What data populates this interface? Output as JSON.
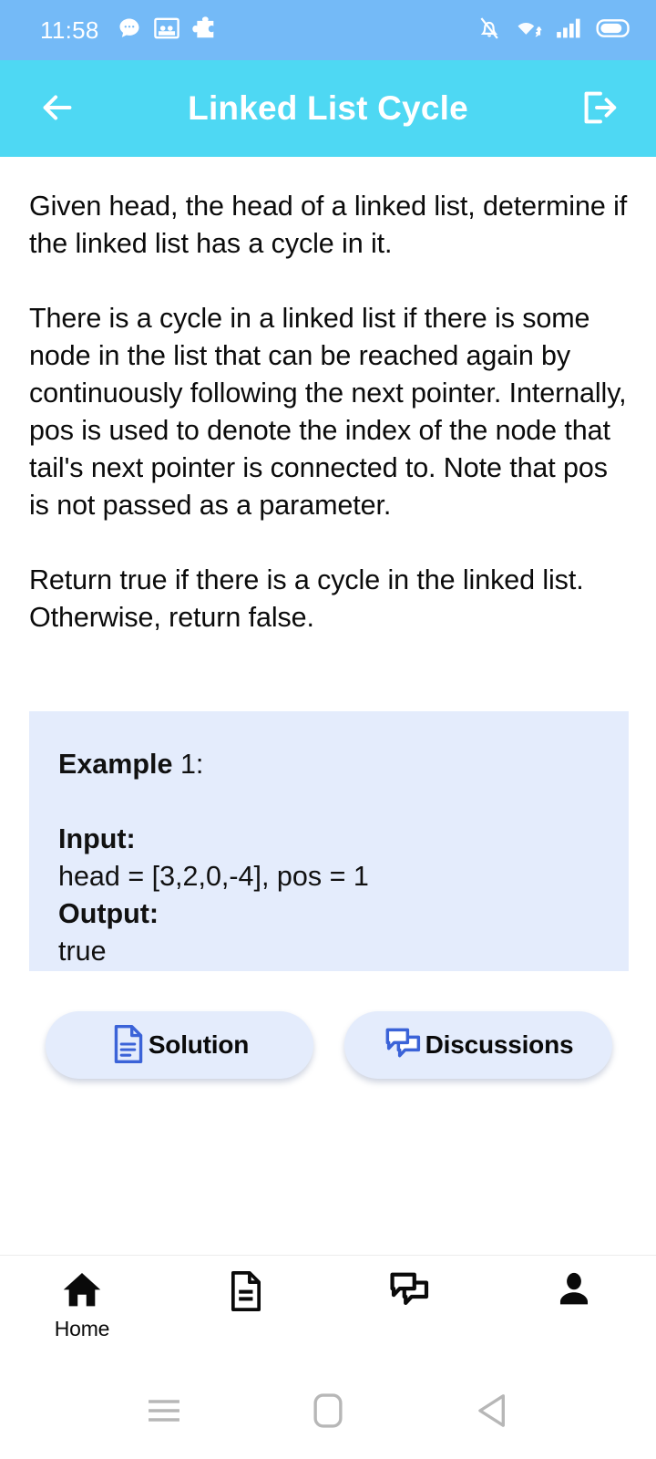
{
  "status_bar": {
    "time": "11:58",
    "left_icons": [
      "chat-bubble-icon",
      "photo-icon",
      "puzzle-piece-icon"
    ],
    "right_icons": [
      "notification-off-icon",
      "wifi-icon",
      "cellular-signal-icon",
      "battery-icon"
    ],
    "background_color": "#74baf7"
  },
  "app_bar": {
    "title": "Linked List Cycle",
    "back_icon": "arrow-left-icon",
    "logout_icon": "logout-icon",
    "background_color": "#4ed8f3",
    "text_color": "#ffffff"
  },
  "problem": {
    "paragraphs": [
      "Given head, the head of a linked list, determine if the linked list has a cycle in it.",
      "There is a cycle in a linked list if there is some node in the list that can be reached again by continuously following the next pointer. Internally, pos is used to denote the index of the node that tail's next pointer is connected to. Note that pos is not passed as a parameter.",
      "Return true if there is a cycle in the linked list. Otherwise, return false."
    ]
  },
  "example": {
    "heading_bold": "Example",
    "heading_rest": " 1:",
    "input_label": "Input:",
    "input_value": "head = [3,2,0,-4], pos = 1",
    "output_label": "Output:",
    "output_value": "true",
    "background_color": "#e4ecfc"
  },
  "actions": [
    {
      "label": "Solution",
      "icon": "document-icon",
      "icon_color": "#3b63d8"
    },
    {
      "label": "Discussions",
      "icon": "chat-bubbles-icon",
      "icon_color": "#3b63d8"
    }
  ],
  "bottom_nav": [
    {
      "label": "Home",
      "icon": "home-icon",
      "active": true
    },
    {
      "label": "",
      "icon": "document-icon",
      "active": false
    },
    {
      "label": "",
      "icon": "chat-bubbles-icon",
      "active": false
    },
    {
      "label": "",
      "icon": "person-icon",
      "active": false
    }
  ],
  "system_nav": [
    {
      "icon": "recents-menu-icon"
    },
    {
      "icon": "home-square-icon"
    },
    {
      "icon": "back-triangle-icon"
    }
  ]
}
